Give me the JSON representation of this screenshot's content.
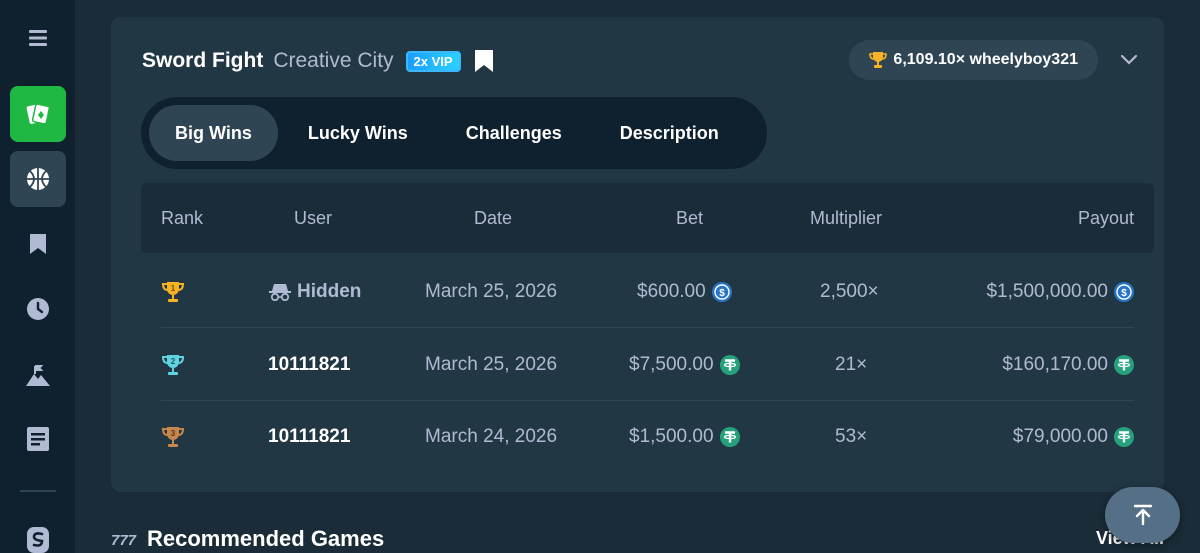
{
  "sidebar": {
    "items": [
      {
        "icon": "menu-icon"
      },
      {
        "icon": "casino-cards-icon",
        "color": "#1fb842"
      },
      {
        "icon": "sports-ball-icon"
      },
      {
        "icon": "bookmark-icon"
      },
      {
        "icon": "clock-icon"
      },
      {
        "icon": "challenge-mountain-icon"
      },
      {
        "icon": "news-icon"
      },
      {
        "icon": "stake-logo-icon"
      }
    ]
  },
  "game": {
    "name": "Sword Fight",
    "provider": "Creative City",
    "badge": "2x VIP"
  },
  "record": {
    "text": "6,109.10× wheelyboy321"
  },
  "tabs": [
    {
      "label": "Big Wins",
      "active": true
    },
    {
      "label": "Lucky Wins",
      "active": false
    },
    {
      "label": "Challenges",
      "active": false
    },
    {
      "label": "Description",
      "active": false
    }
  ],
  "table": {
    "headers": {
      "rank": "Rank",
      "user": "User",
      "date": "Date",
      "bet": "Bet",
      "multiplier": "Multiplier",
      "payout": "Payout"
    },
    "rows": [
      {
        "rank_icon": "gold-trophy-icon",
        "user": "Hidden",
        "date": "March 25, 2026",
        "bet": "$600.00",
        "coin": "usdc-icon",
        "multiplier": "2,500×",
        "payout": "$1,500,000.00"
      },
      {
        "rank_icon": "silver-trophy-icon",
        "user": "10111821",
        "date": "March 25, 2026",
        "bet": "$7,500.00",
        "coin": "usdt-icon",
        "multiplier": "21×",
        "payout": "$160,170.00"
      },
      {
        "rank_icon": "bronze-trophy-icon",
        "user": "10111821",
        "date": "March 24, 2026",
        "bet": "$1,500.00",
        "coin": "usdt-icon",
        "multiplier": "53×",
        "payout": "$79,000.00"
      }
    ]
  },
  "recommended": {
    "title": "Recommended Games",
    "view_all": "View All"
  },
  "colors": {
    "background": "#1a2c38",
    "card": "#213743",
    "sidebar": "#0f212e",
    "accent_green": "#1fb842",
    "muted_text": "#b1bad3",
    "usdc_blue": "#2775ca",
    "usdt_green": "#26a17b",
    "gold": "#f5b325",
    "silver": "#5fd3e0",
    "bronze": "#c8874a"
  }
}
